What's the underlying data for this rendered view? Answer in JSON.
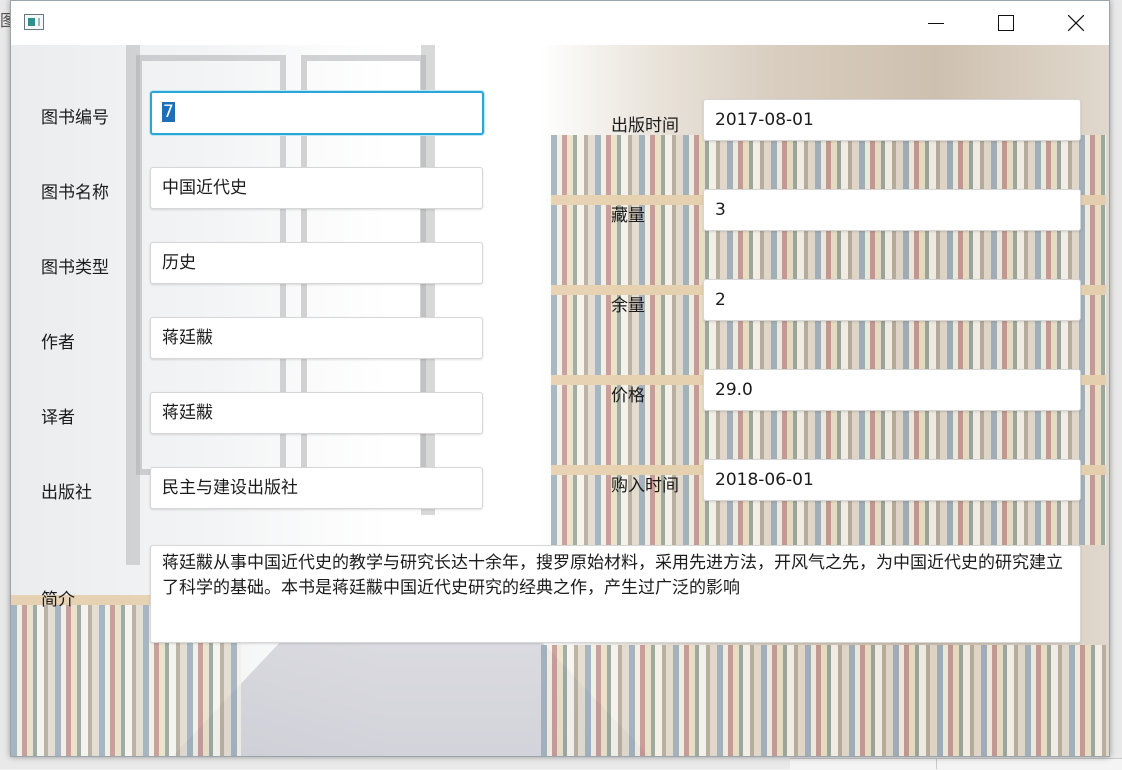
{
  "window": {
    "controls": {
      "minimize_icon": "minimize-icon",
      "maximize_icon": "maximize-icon",
      "close_icon": "close-icon"
    }
  },
  "behind_window_fragment": "图",
  "form": {
    "book_id": {
      "label": "图书编号",
      "value": "7"
    },
    "book_name": {
      "label": "图书名称",
      "value": "中国近代史"
    },
    "book_type": {
      "label": "图书类型",
      "value": "历史"
    },
    "author": {
      "label": "作者",
      "value": "蒋廷黻"
    },
    "translator": {
      "label": "译者",
      "value": "蒋廷黻"
    },
    "publisher": {
      "label": "出版社",
      "value": "民主与建设出版社"
    },
    "publish_date": {
      "label": "出版时间",
      "value": "2017-08-01"
    },
    "stock": {
      "label": "藏量",
      "value": "3"
    },
    "remaining": {
      "label": "余量",
      "value": "2"
    },
    "price": {
      "label": "价格",
      "value": "29.0"
    },
    "purchase_date": {
      "label": "购入时间",
      "value": "2018-06-01"
    },
    "summary": {
      "label": "简介",
      "value": "蒋廷黻从事中国近代史的教学与研究长达十余年，搜罗原始材料，采用先进方法，开风气之先，为中国近代史的研究建立了科学的基础。本书是蒋廷黻中国近代史研究的经典之作，产生过广泛的影响"
    }
  },
  "colors": {
    "focus_border": "#2aa6d6",
    "selection": "#1e6fb8"
  }
}
